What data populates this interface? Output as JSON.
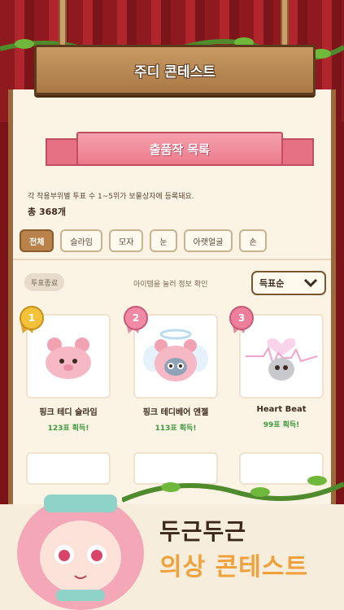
{
  "header": {
    "title": "주디 콘테스트"
  },
  "section": {
    "title": "출품작 목록"
  },
  "info": {
    "description": "각 착용부위별 투표 수 1~5위가 보물상자에 등록돼요.",
    "total": "총 368개"
  },
  "tabs": [
    {
      "label": "전체",
      "active": true
    },
    {
      "label": "슬라임"
    },
    {
      "label": "모자"
    },
    {
      "label": "눈"
    },
    {
      "label": "아랫얼굴"
    },
    {
      "label": "손"
    }
  ],
  "filter": {
    "status": "투표종료",
    "hint": "아이템을 눌러 정보 확인",
    "sort": "득표순"
  },
  "entries": [
    {
      "rank": "1",
      "name": "핑크 테디 슬라임",
      "votes": "123표 획득!"
    },
    {
      "rank": "2",
      "name": "핑크 테디베어 엔젤",
      "votes": "113표 획득!"
    },
    {
      "rank": "3",
      "name": "Heart Beat",
      "votes": "99표 획득!"
    }
  ],
  "promo": {
    "line1": "두근두근",
    "line2": "의상 콘테스트"
  },
  "colors": {
    "accent": "#b8824a",
    "ribbon": "#ea7a8b",
    "vote": "#3f9a3f",
    "promo_orange": "#f0a13b"
  }
}
